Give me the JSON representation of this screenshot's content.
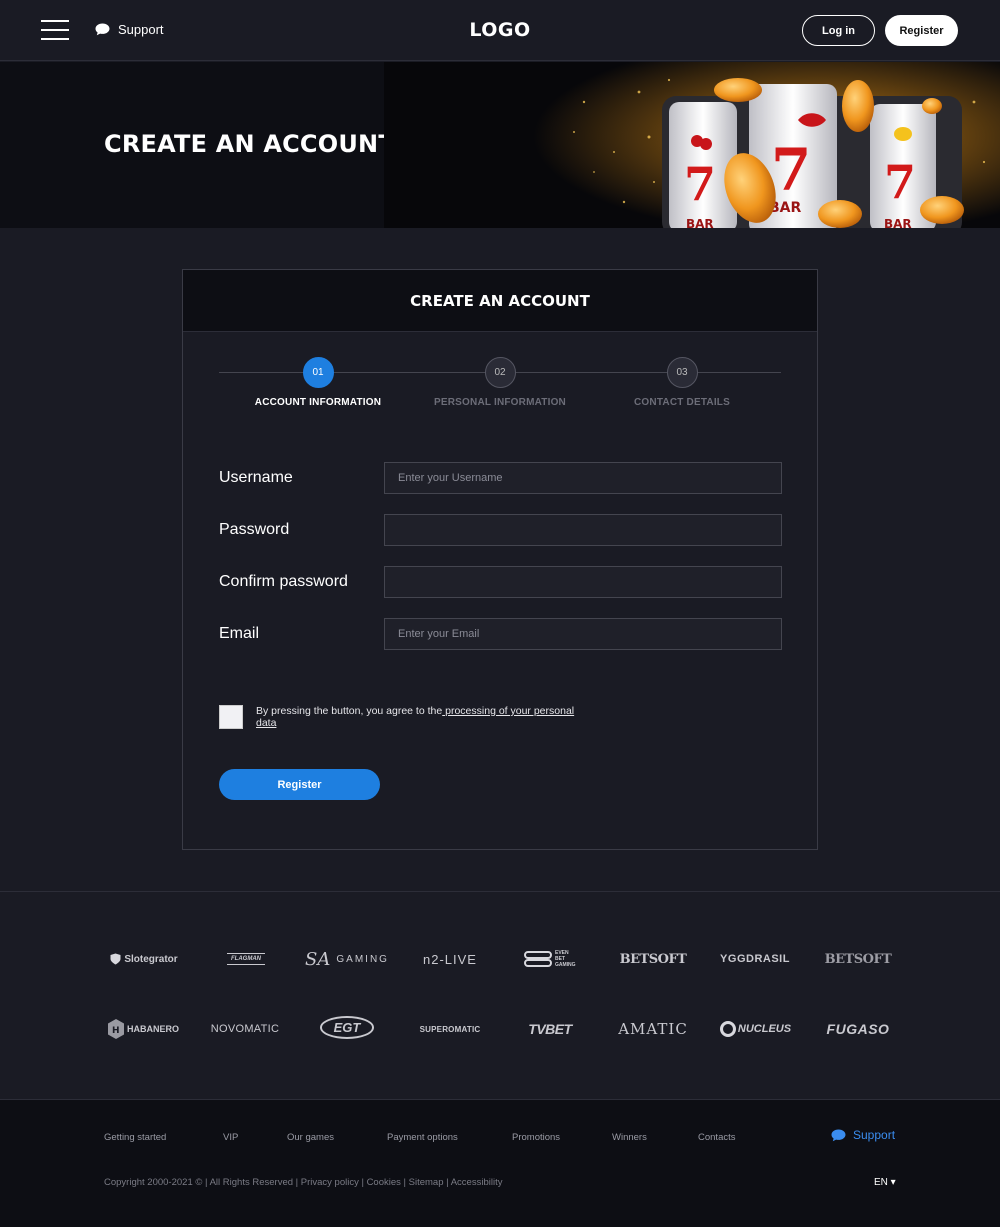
{
  "header": {
    "support_label": "Support",
    "logo": "LOGO",
    "login_label": "Log in",
    "register_label": "Register"
  },
  "hero": {
    "title": "CREATE AN ACCOUNT"
  },
  "form": {
    "title": "CREATE AN ACCOUNT",
    "steps": [
      {
        "number": "01",
        "label": "ACCOUNT INFORMATION",
        "active": true
      },
      {
        "number": "02",
        "label": "PERSONAL INFORMATION",
        "active": false
      },
      {
        "number": "03",
        "label": "CONTACT DETAILS",
        "active": false
      }
    ],
    "fields": {
      "username": {
        "label": "Username",
        "placeholder": "Enter your Username",
        "value": ""
      },
      "password": {
        "label": "Password",
        "placeholder": "",
        "value": ""
      },
      "confirm_password": {
        "label": "Confirm password",
        "placeholder": "",
        "value": ""
      },
      "email": {
        "label": "Email",
        "placeholder": "Enter your Email",
        "value": ""
      }
    },
    "agree_text": "By pressing the button, you agree to the",
    "agree_link": " processing of your personal data",
    "submit_label": "Register"
  },
  "providers": {
    "row1": [
      "Slotegrator",
      "FLAGMAN",
      "GAMING",
      "n2-LIVE",
      "EVEN BET GAMING",
      "BETSOFT",
      "YGGDRASIL",
      "BETSOFT"
    ],
    "row2": [
      "HABANERO",
      "NOVOMATIC",
      "EGT",
      "SUPEROMATIC",
      "TVBET",
      "AMATIC",
      "NUCLEUS",
      "FUGASO"
    ]
  },
  "footer": {
    "links": [
      "Getting started",
      "VIP",
      "Our games",
      "Payment options",
      "Promotions",
      "Winners",
      "Contacts"
    ],
    "support_label": "Support",
    "copyright": "Copyright 2000-2021 © | All Rights Reserved | Privacy policy | Cookies | Sitemap | Accessibility",
    "language": "EN ▾"
  },
  "colors": {
    "background": "#1a1b24",
    "panel_dark": "#0d0e14",
    "accent_blue": "#1e7fe0",
    "border": "#44454f"
  }
}
